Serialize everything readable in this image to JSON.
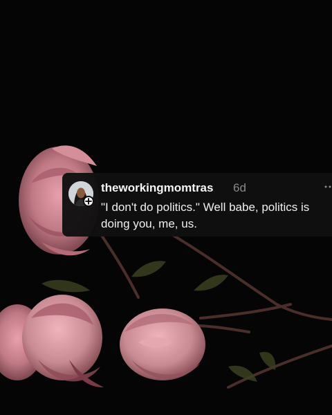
{
  "post": {
    "username": "theworkingmomtras",
    "timestamp": "6d",
    "text": "\"I don't do politics.\" Well babe, politics is doing you, me, us.",
    "avatar_icon": "profile-photo",
    "follow_icon": "plus-icon",
    "more_icon": "more-horizontal-icon"
  },
  "colors": {
    "background": "#050505",
    "card": "#101011",
    "username": "#f5f5f5",
    "timestamp": "#8a8a8a",
    "rose": "#c07a86"
  }
}
